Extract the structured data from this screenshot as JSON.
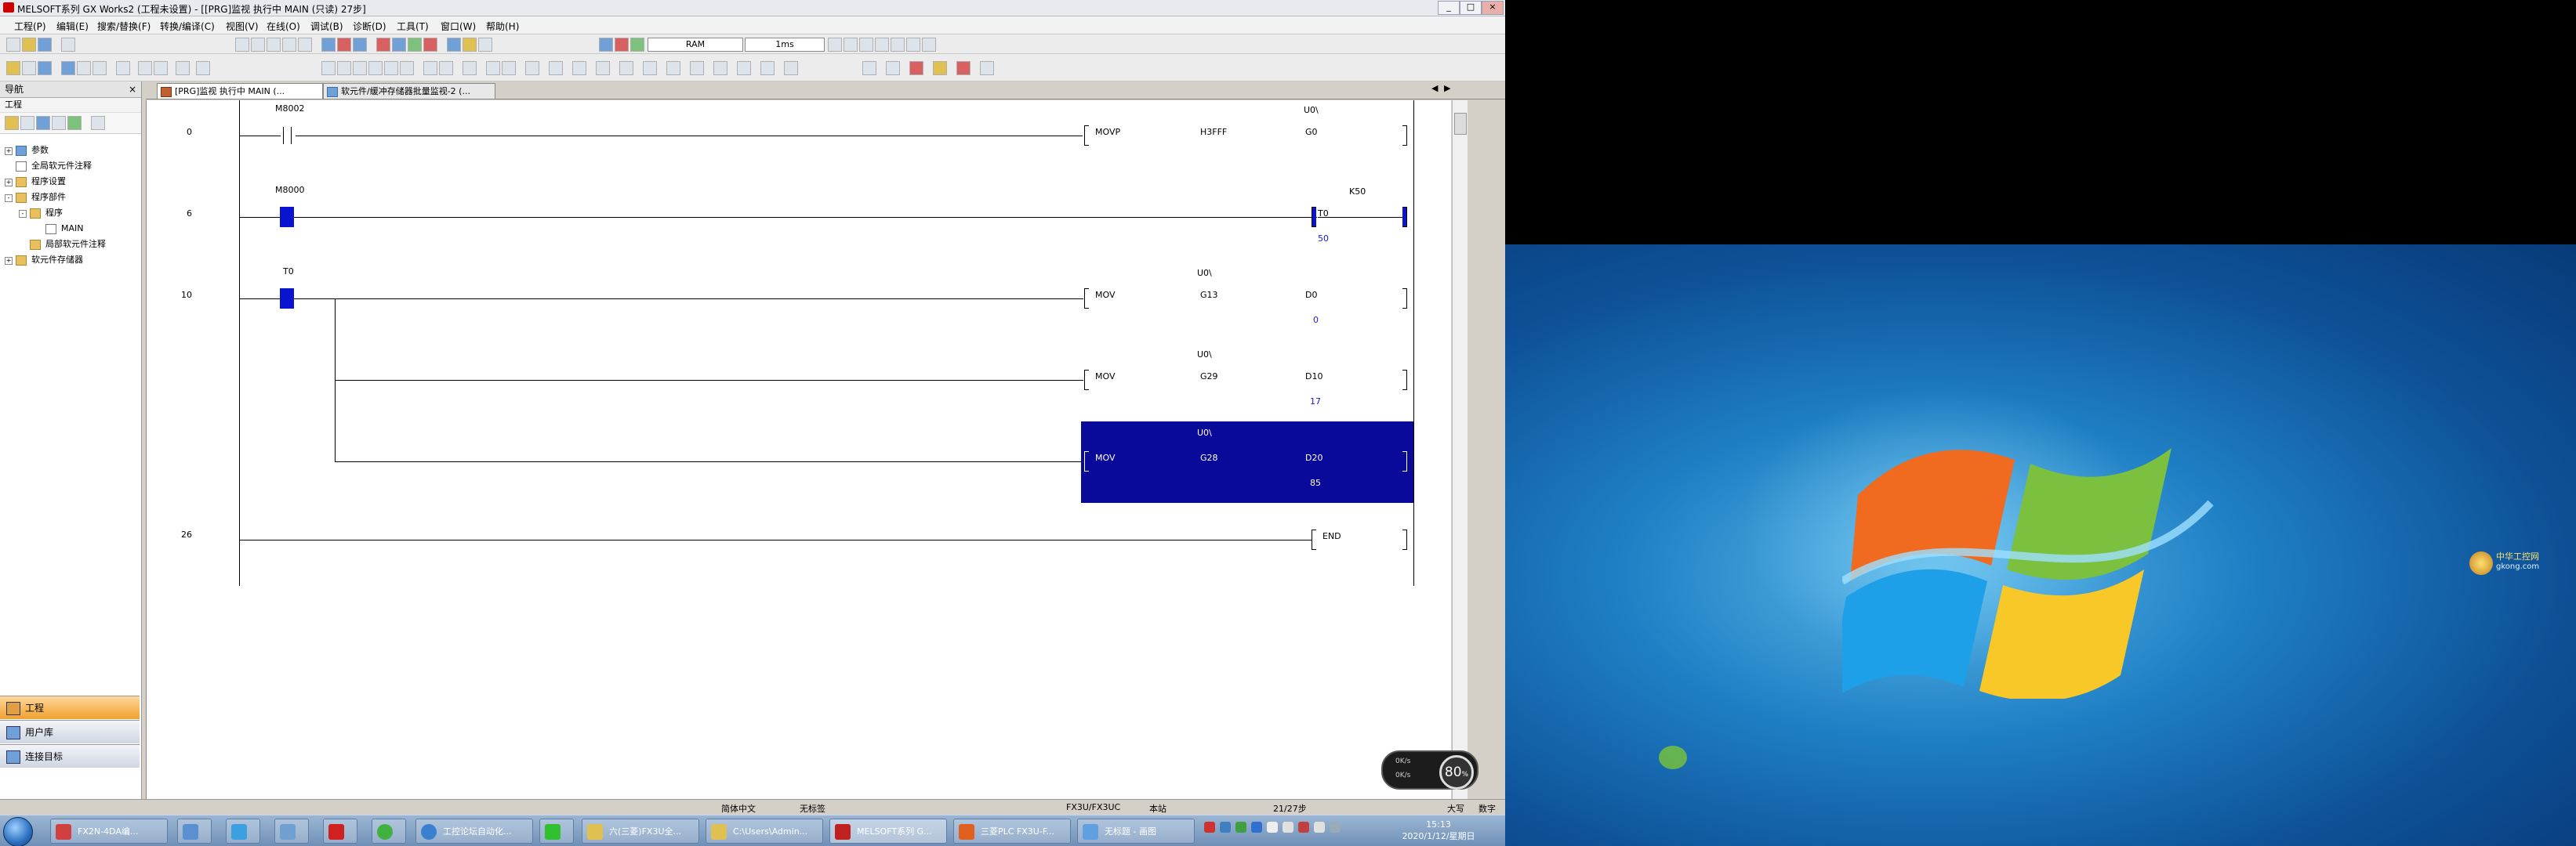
{
  "window": {
    "title": "MELSOFT系列 GX Works2 (工程未设置) - [[PRG]监视 执行中 MAIN (只读) 27步]",
    "min": "_",
    "restore": "□",
    "close": "×"
  },
  "menu": [
    "工程(P)",
    "编辑(E)",
    "搜索/替换(F)",
    "转换/编译(C)",
    "视图(V)",
    "在线(O)",
    "调试(B)",
    "诊断(D)",
    "工具(T)",
    "窗口(W)",
    "帮助(H)"
  ],
  "toolbar": {
    "memory": "RAM",
    "scan": "1ms"
  },
  "nav": {
    "title": "导航",
    "pin": "ㅍ",
    "close": "×",
    "section": "工程",
    "tree": [
      {
        "label": "参数",
        "indent": 0,
        "exp": "+"
      },
      {
        "label": "全局软元件注释",
        "indent": 0,
        "exp": ""
      },
      {
        "label": "程序设置",
        "indent": 0,
        "exp": "+"
      },
      {
        "label": "程序部件",
        "indent": 0,
        "exp": "-"
      },
      {
        "label": "程序",
        "indent": 1,
        "exp": "-"
      },
      {
        "label": "MAIN",
        "indent": 2,
        "exp": ""
      },
      {
        "label": "局部软元件注释",
        "indent": 1,
        "exp": ""
      },
      {
        "label": "软元件存储器",
        "indent": 0,
        "exp": "+"
      }
    ],
    "buttons": [
      "工程",
      "用户库",
      "连接目标"
    ]
  },
  "tabs": [
    {
      "label": "[PRG]监视 执行中 MAIN (...",
      "active": true
    },
    {
      "label": "软元件/缓冲存储器批量监视-2 (...",
      "active": false
    }
  ],
  "ladder": {
    "rungs": [
      {
        "step": "0",
        "contact": "M8002",
        "instr": "MOVP",
        "src": "H3FFF",
        "dstTop": "U0\\",
        "dst": "G0",
        "val": ""
      },
      {
        "step": "6",
        "contact": "M8000",
        "instr": "",
        "src": "",
        "dstTop": "K50",
        "dst": "T0",
        "val": "50"
      },
      {
        "step": "10",
        "contact": "T0",
        "instr": "MOV",
        "src": "G13",
        "srcTop": "U0\\",
        "dst": "D0",
        "val": "0"
      },
      {
        "step": "",
        "contact": "",
        "instr": "MOV",
        "src": "G29",
        "srcTop": "U0\\",
        "dst": "D10",
        "val": "17"
      },
      {
        "step": "",
        "contact": "",
        "instr": "MOV",
        "src": "G28",
        "srcTop": "U0\\",
        "dst": "D20",
        "val": "85"
      },
      {
        "step": "26",
        "contact": "",
        "instr": "END",
        "src": "",
        "dst": "",
        "val": ""
      }
    ]
  },
  "statusbar": {
    "lang": "简体中文",
    "label": "无标签",
    "plc": "FX3U/FX3UC",
    "station": "本站",
    "steps": "21/27步",
    "case": "大写",
    "num": "数字"
  },
  "gauge": {
    "percent": "80",
    "unit": "%",
    "up": "0K/s",
    "down": "0K/s"
  },
  "taskbar": {
    "tasks": [
      "FX2N-4DA编...",
      "",
      "",
      "",
      "",
      "",
      "工控论坛自动化...",
      "",
      "六(三菱)FX3U全...",
      "C:\\Users\\Admin...",
      "MELSOFT系列 G...",
      "三菱PLC FX3U-F...",
      "无标题 - 画图"
    ],
    "time": "15:13",
    "date": "2020/1/12/星期日"
  },
  "watermark": {
    "line1": "中华工控网",
    "line2": "gkong.com"
  },
  "colors": {
    "selection": "#0a0a9a",
    "onContact": "#0a14d0",
    "value": "#1a1ad0"
  }
}
